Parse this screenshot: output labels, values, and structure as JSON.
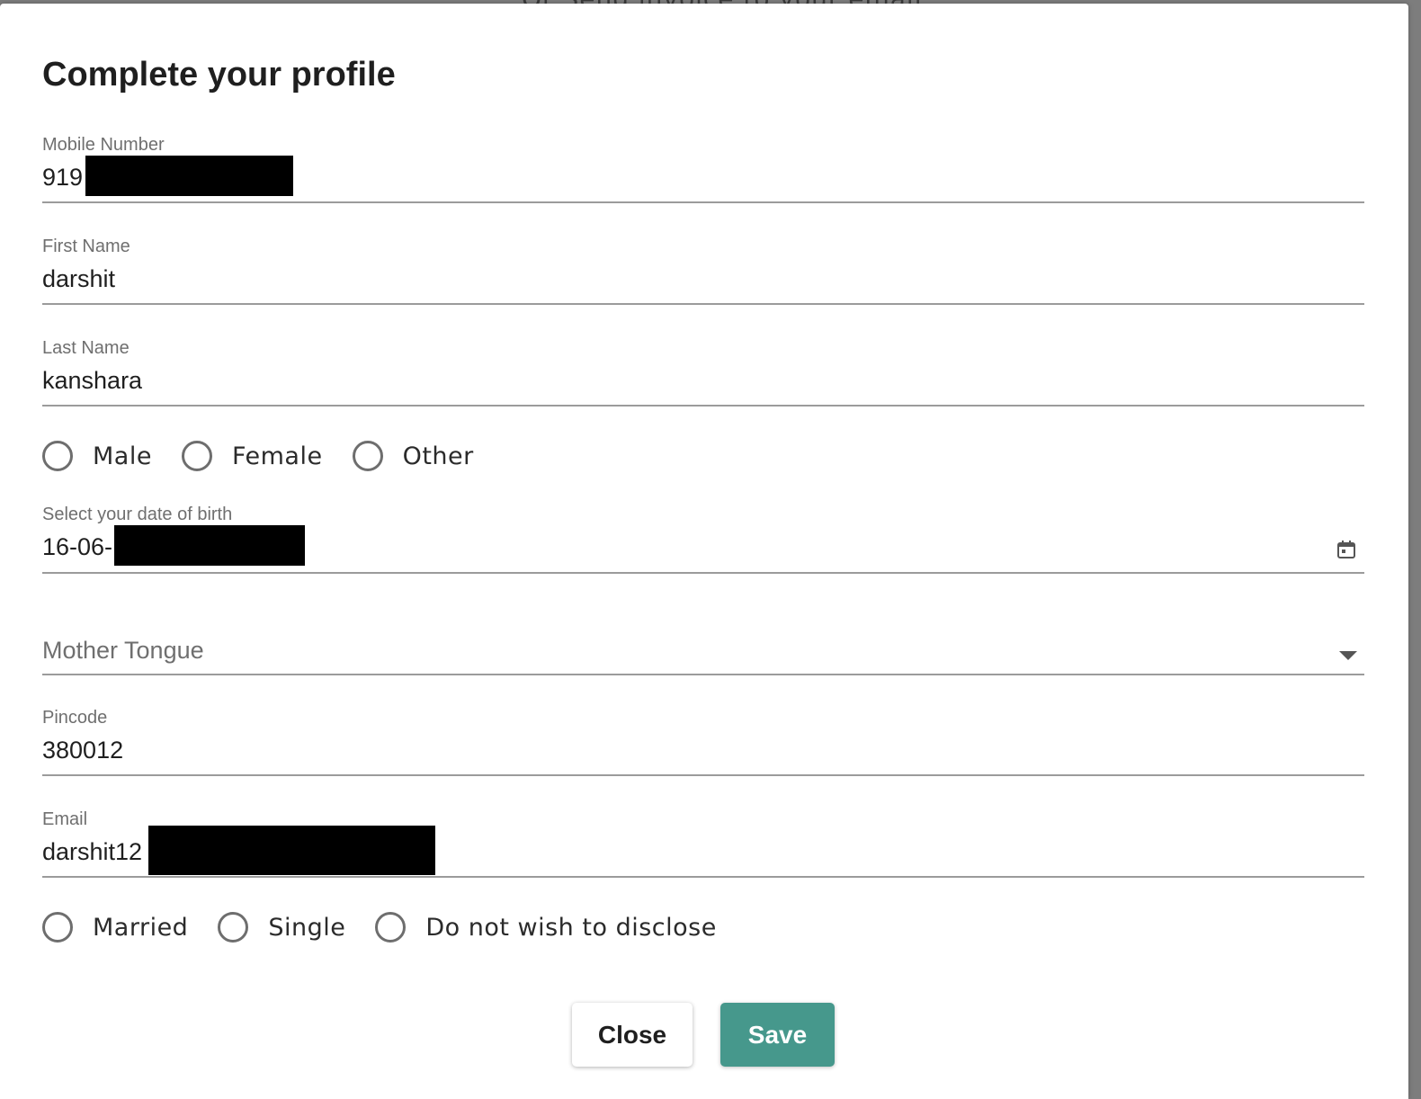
{
  "backdrop": {
    "text": "Or Send invoice to your email"
  },
  "dialog": {
    "title": "Complete your profile",
    "fields": {
      "mobile": {
        "label": "Mobile Number",
        "value": "919"
      },
      "first_name": {
        "label": "First Name",
        "value": "darshit"
      },
      "last_name": {
        "label": "Last Name",
        "value": "kanshara"
      },
      "dob": {
        "label": "Select your date of birth",
        "value": "16-06-"
      },
      "mother_tongue": {
        "placeholder": "Mother Tongue"
      },
      "pincode": {
        "label": "Pincode",
        "value": "380012"
      },
      "email": {
        "label": "Email",
        "value": "darshit12"
      }
    },
    "gender_options": [
      "Male",
      "Female",
      "Other"
    ],
    "marital_options": [
      "Married",
      "Single",
      "Do not wish to disclose"
    ],
    "buttons": {
      "close": "Close",
      "save": "Save"
    }
  },
  "colors": {
    "save_button": "#46988c",
    "underline": "#9b9b9b",
    "label": "#6f6f6f"
  },
  "icons": {
    "dob": "calendar-icon",
    "mother_tongue": "dropdown-arrow-icon"
  }
}
